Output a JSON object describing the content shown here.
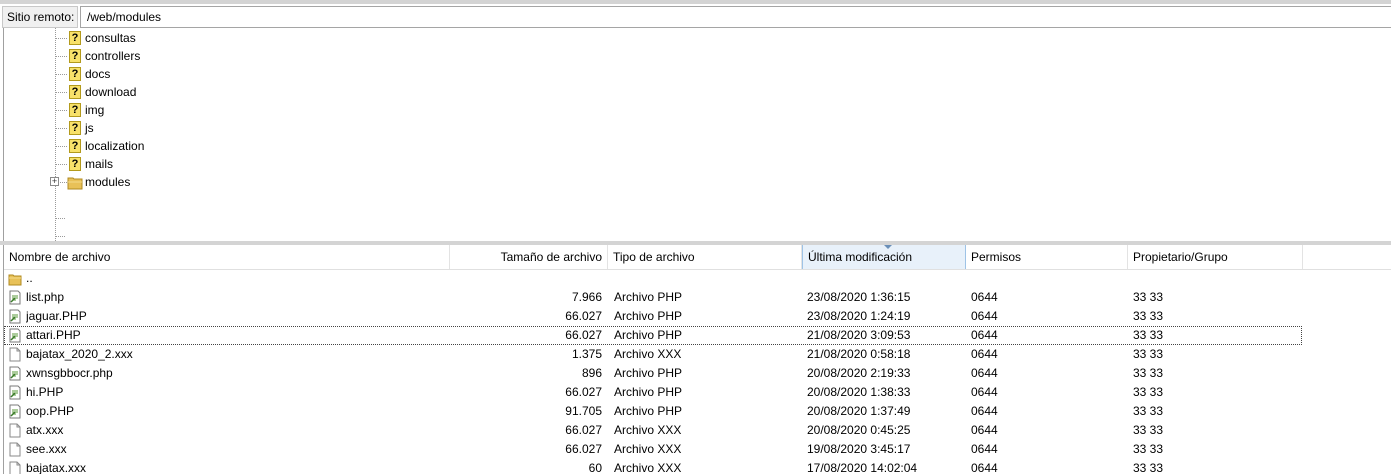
{
  "remote_site": {
    "label": "Sitio remoto:",
    "path": "/web/modules"
  },
  "tree": {
    "items": [
      {
        "name": "consultas",
        "icon": "unknown-folder-icon"
      },
      {
        "name": "controllers",
        "icon": "unknown-folder-icon"
      },
      {
        "name": "docs",
        "icon": "unknown-folder-icon"
      },
      {
        "name": "download",
        "icon": "unknown-folder-icon"
      },
      {
        "name": "img",
        "icon": "unknown-folder-icon"
      },
      {
        "name": "js",
        "icon": "unknown-folder-icon"
      },
      {
        "name": "localization",
        "icon": "unknown-folder-icon"
      },
      {
        "name": "mails",
        "icon": "unknown-folder-icon"
      },
      {
        "name": "modules",
        "icon": "folder-icon",
        "expander": "+"
      }
    ]
  },
  "file_list": {
    "columns": {
      "name": "Nombre de archivo",
      "size": "Tamaño de archivo",
      "type": "Tipo de archivo",
      "modified": "Última modificación",
      "perms": "Permisos",
      "owner": "Propietario/Grupo"
    },
    "parent": "..",
    "rows": [
      {
        "name": "list.php",
        "size": "7.966",
        "type": "Archivo PHP",
        "modified": "23/08/2020 1:36:15",
        "perms": "0644",
        "owner": "33 33",
        "icon": "php-file-icon"
      },
      {
        "name": "jaguar.PHP",
        "size": "66.027",
        "type": "Archivo PHP",
        "modified": "23/08/2020 1:24:19",
        "perms": "0644",
        "owner": "33 33",
        "icon": "php-file-icon"
      },
      {
        "name": "attari.PHP",
        "size": "66.027",
        "type": "Archivo PHP",
        "modified": "21/08/2020 3:09:53",
        "perms": "0644",
        "owner": "33 33",
        "icon": "php-file-icon",
        "focused": true
      },
      {
        "name": "bajatax_2020_2.xxx",
        "size": "1.375",
        "type": "Archivo XXX",
        "modified": "21/08/2020 0:58:18",
        "perms": "0644",
        "owner": "33 33",
        "icon": "blank-file-icon"
      },
      {
        "name": "xwnsgbbocr.php",
        "size": "896",
        "type": "Archivo PHP",
        "modified": "20/08/2020 2:19:33",
        "perms": "0644",
        "owner": "33 33",
        "icon": "php-file-icon"
      },
      {
        "name": "hi.PHP",
        "size": "66.027",
        "type": "Archivo PHP",
        "modified": "20/08/2020 1:38:33",
        "perms": "0644",
        "owner": "33 33",
        "icon": "php-file-icon"
      },
      {
        "name": "oop.PHP",
        "size": "91.705",
        "type": "Archivo PHP",
        "modified": "20/08/2020 1:37:49",
        "perms": "0644",
        "owner": "33 33",
        "icon": "php-file-icon"
      },
      {
        "name": "atx.xxx",
        "size": "66.027",
        "type": "Archivo XXX",
        "modified": "20/08/2020 0:45:25",
        "perms": "0644",
        "owner": "33 33",
        "icon": "blank-file-icon"
      },
      {
        "name": "see.xxx",
        "size": "66.027",
        "type": "Archivo XXX",
        "modified": "19/08/2020 3:45:17",
        "perms": "0644",
        "owner": "33 33",
        "icon": "blank-file-icon"
      },
      {
        "name": "bajatax.xxx",
        "size": "60",
        "type": "Archivo XXX",
        "modified": "17/08/2020 14:02:04",
        "perms": "0644",
        "owner": "33 33",
        "icon": "blank-file-icon"
      }
    ]
  }
}
